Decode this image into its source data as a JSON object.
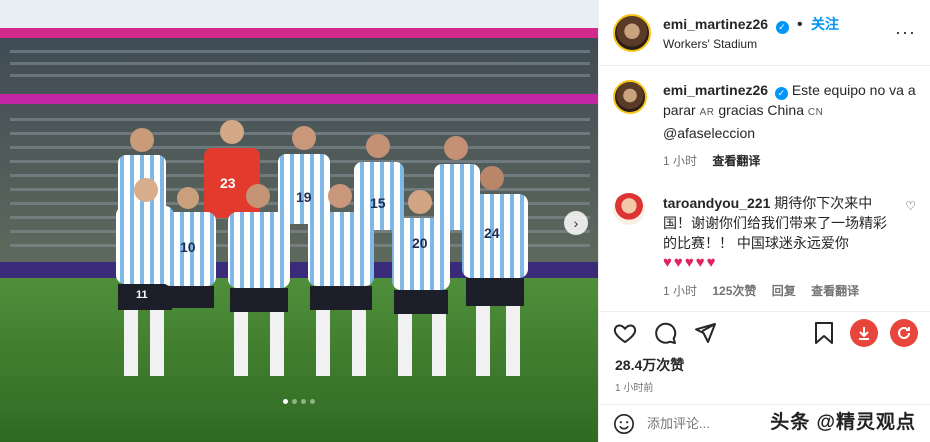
{
  "post": {
    "photo_alt": "",
    "carousel": {
      "dots": 4,
      "active": 0
    }
  },
  "jerseys": {
    "keeper": "23",
    "back_left": "19",
    "back_right": "15",
    "front_1": "10",
    "front_2": "20",
    "front_3": "24",
    "front_4": "11"
  },
  "header": {
    "username": "emi_martinez26",
    "separator": "•",
    "follow_label": "关注",
    "location": "Workers' Stadium",
    "more": "···"
  },
  "caption": {
    "username": "emi_martinez26",
    "text_1": "Este equipo no va a parar",
    "tag_ar": "AR",
    "text_2": "gracias China",
    "tag_cn": "CN",
    "mention": "@afaseleccion",
    "time": "1 小时",
    "translate": "查看翻译"
  },
  "comment": {
    "username": "taroandyou_221",
    "text": "期待你下次来中国！谢谢你们给我们带来了一场精彩的比赛！！ 中国球迷永远爱你",
    "hearts": "♥♥♥♥♥",
    "time": "1 小时",
    "likes": "125次赞",
    "reply": "回复",
    "translate": "查看翻译"
  },
  "stats": {
    "likes": "28.4万次赞",
    "time": "1 小时前"
  },
  "add_comment": {
    "placeholder": "添加评论..."
  },
  "watermark": "头条 @精灵观点",
  "colors": {
    "accent": "#0095f6",
    "heart": "#e0245e",
    "download_btn": "#e8453c"
  }
}
